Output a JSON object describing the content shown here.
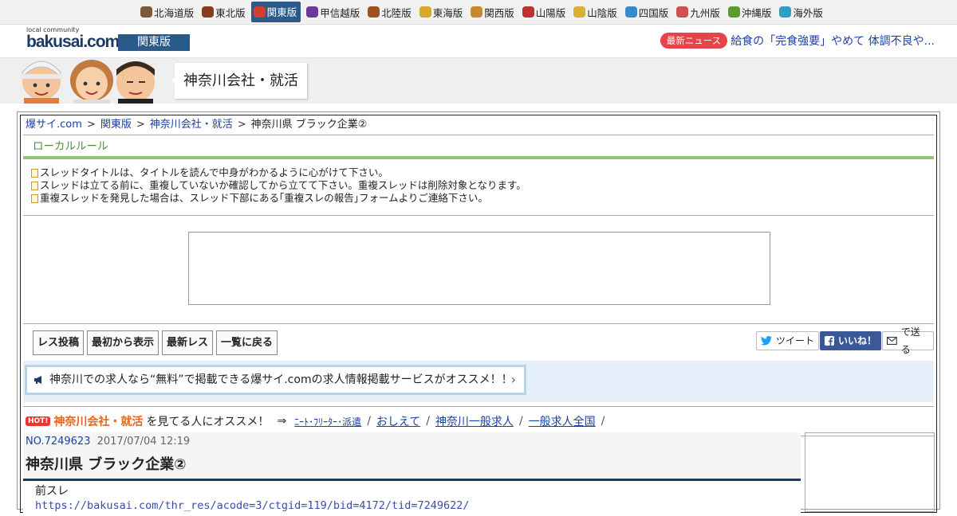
{
  "regions": [
    {
      "label": "北海道版",
      "color": "#7a5a3a"
    },
    {
      "label": "東北版",
      "color": "#8a3a20"
    },
    {
      "label": "関東版",
      "color": "#d04030",
      "active": true
    },
    {
      "label": "甲信越版",
      "color": "#6a3a9a"
    },
    {
      "label": "北陸版",
      "color": "#a05020"
    },
    {
      "label": "東海版",
      "color": "#d8a830"
    },
    {
      "label": "関西版",
      "color": "#c88830"
    },
    {
      "label": "山陽版",
      "color": "#c03030"
    },
    {
      "label": "山陰版",
      "color": "#d8b030"
    },
    {
      "label": "四国版",
      "color": "#3a8ad0"
    },
    {
      "label": "九州版",
      "color": "#d05050"
    },
    {
      "label": "沖縄版",
      "color": "#5a9a30"
    },
    {
      "label": "海外版",
      "color": "#30a0c0"
    }
  ],
  "header": {
    "logo_small": "local community",
    "logo_big": "bakusai.com",
    "edition": "関東版",
    "news_badge": "最新ニュース",
    "news_text": "給食の「完食強要」やめて 体調不良や..."
  },
  "banner": {
    "title": "神奈川会社・就活"
  },
  "breadcrumb": {
    "items": [
      "爆サイ.com",
      "関東版",
      "神奈川会社・就活"
    ],
    "current": "神奈川県 ブラック企業②",
    "sep": ">"
  },
  "local_rule": {
    "label": "ローカルルール"
  },
  "rules": [
    "スレッドタイトルは、タイトルを読んで中身がわかるように心がけて下さい。",
    "スレッドは立てる前に、重複していないか確認してから立てて下さい。重複スレッドは削除対象となります。",
    "重複スレッドを発見した場合は、スレッド下部にある｢重複スレの報告｣フォームよりご連絡下さい。"
  ],
  "toolbar": {
    "post": "レス投稿",
    "from_start": "最初から表示",
    "latest": "最新レス",
    "back": "一覧に戻る",
    "tweet": "ツイート",
    "like": "いいね！",
    "send": "で送る"
  },
  "promo": {
    "text": "神奈川での求人なら“無料”で掲載できる爆サイ.comの求人情報掲載サービスがオススメ！！"
  },
  "hot": {
    "badge": "HOT!",
    "category": "神奈川会社・就活",
    "suffix": "を見てる人にオススメ！",
    "arrow": "⇒",
    "links": [
      "ﾆｰﾄ･ﾌﾘｰﾀｰ･派遣",
      "おしえて",
      "神奈川一般求人",
      "一般求人全国"
    ]
  },
  "post": {
    "no": "NO.7249623",
    "date": "2017/07/04 12:19",
    "title": "神奈川県 ブラック企業②",
    "body_line1": "前スレ",
    "body_link": "https://bakusai.com/thr_res/acode=3/ctgid=119/bid=4172/tid=7249622/"
  }
}
